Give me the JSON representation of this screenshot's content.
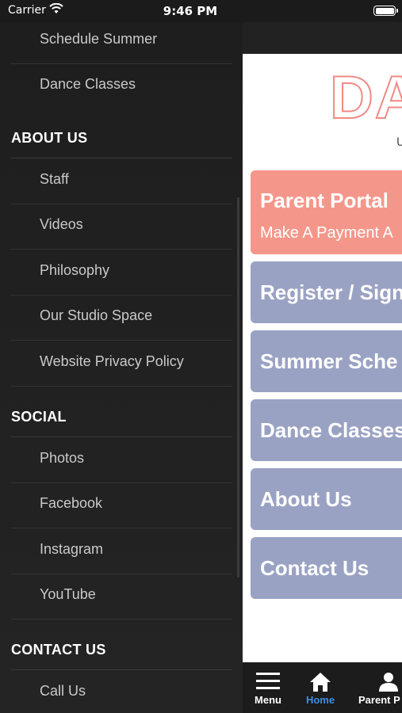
{
  "status_bar": {
    "carrier": "Carrier",
    "time": "9:46 PM"
  },
  "drawer": {
    "items_top": [
      {
        "label": "Schedule Summer"
      },
      {
        "label": "Dance Classes"
      }
    ],
    "about": {
      "heading": "ABOUT US",
      "items": [
        {
          "label": "Staff"
        },
        {
          "label": "Videos"
        },
        {
          "label": "Philosophy"
        },
        {
          "label": "Our Studio Space"
        },
        {
          "label": "Website Privacy Policy"
        }
      ]
    },
    "social": {
      "heading": "SOCIAL",
      "items": [
        {
          "label": "Photos"
        },
        {
          "label": "Facebook"
        },
        {
          "label": "Instagram"
        },
        {
          "label": "YouTube"
        }
      ]
    },
    "contact": {
      "heading": "CONTACT US",
      "items": [
        {
          "label": "Call Us"
        }
      ]
    }
  },
  "main": {
    "logo_text": "DA",
    "logo_sub": "U",
    "tiles": [
      {
        "label": "Parent Portal",
        "sub": "Make A Payment A",
        "color": "#f4978a"
      },
      {
        "label": "Register / Sign",
        "color": "#9aa2c4"
      },
      {
        "label": "Summer Sche",
        "color": "#9aa2c4"
      },
      {
        "label": "Dance Classes",
        "color": "#9aa2c4"
      },
      {
        "label": "About Us",
        "color": "#9aa2c4"
      },
      {
        "label": "Contact Us",
        "color": "#9aa2c4"
      }
    ]
  },
  "tab_bar": {
    "tabs": [
      {
        "label": "Menu",
        "icon": "hamburger-icon"
      },
      {
        "label": "Home",
        "icon": "home-icon",
        "active": true
      },
      {
        "label": "Parent P",
        "icon": "person-icon"
      }
    ],
    "active_color": "#3b8ee8"
  }
}
